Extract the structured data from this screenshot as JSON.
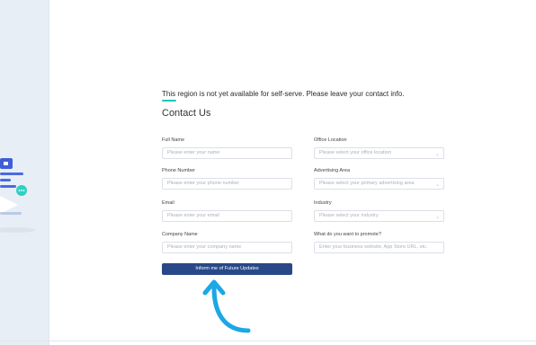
{
  "notice": "This region is not yet available for self-serve. Please leave your contact info.",
  "title": "Contact Us",
  "form": {
    "left": [
      {
        "label": "Full Name",
        "placeholder": "Please enter your name"
      },
      {
        "label": "Phone Number",
        "placeholder": "Please enter your phone number"
      },
      {
        "label": "Email",
        "placeholder": "Please enter your email"
      },
      {
        "label": "Company Name",
        "placeholder": "Please enter your company name"
      }
    ],
    "right": [
      {
        "label": "Office Location",
        "placeholder": "Please select your office location",
        "type": "select"
      },
      {
        "label": "Advertising Area",
        "placeholder": "Please select your primary advertising area",
        "type": "select"
      },
      {
        "label": "Industry",
        "placeholder": "Please select your industry",
        "type": "select"
      },
      {
        "label": "What do you want to promote?",
        "placeholder": "Enter your business website, App Store URL, etc.",
        "type": "text"
      }
    ],
    "submit_label": "Inform me of Future Updates"
  },
  "icons": {
    "select_arrow": "chevron-down-icon",
    "pointer": "curved-arrow-icon",
    "illustration": "chat-illustration-icon"
  },
  "colors": {
    "accent": "#20c7b8",
    "button": "#284887",
    "arrow": "#1ca7e6",
    "left_panel": "#e8eef6"
  }
}
